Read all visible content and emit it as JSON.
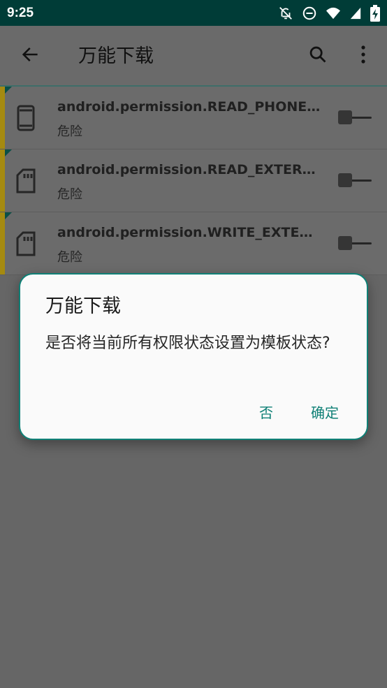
{
  "status_bar": {
    "time": "9:25",
    "icons": [
      "notifications-off-icon",
      "do-not-disturb-icon",
      "wifi-icon",
      "cellular-signal-icon",
      "battery-charging-icon"
    ]
  },
  "app_bar": {
    "title": "万能下载",
    "icons": [
      "back-arrow-icon",
      "search-icon",
      "more-vertical-icon"
    ]
  },
  "permissions": [
    {
      "name": "android.permission.READ_PHONE_…",
      "level": "危险",
      "icon": "phone-icon",
      "enabled": false
    },
    {
      "name": "android.permission.READ_EXTERN…",
      "level": "危险",
      "icon": "sd-card-icon",
      "enabled": false
    },
    {
      "name": "android.permission.WRITE_EXTERN…",
      "level": "危险",
      "icon": "sd-card-icon",
      "enabled": false
    }
  ],
  "dialog": {
    "title": "万能下载",
    "message": "是否将当前所有权限状态设置为模板状态?",
    "negative_label": "否",
    "positive_label": "确定"
  },
  "colors": {
    "accent": "#0f8076",
    "status_bar": "#003c37",
    "danger_marker": "#a58a10"
  }
}
